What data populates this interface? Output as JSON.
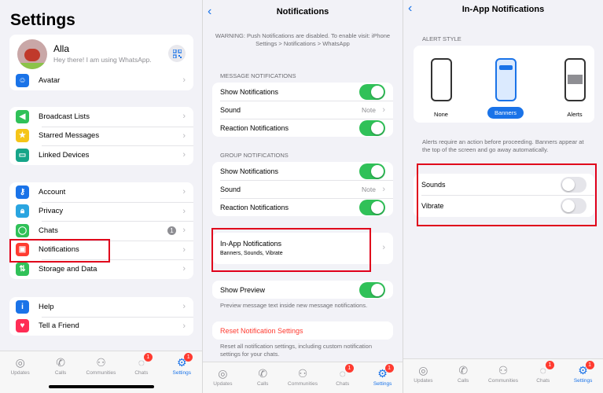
{
  "settings": {
    "title": "Settings",
    "profile": {
      "name": "Alla",
      "status": "Hey there! I am using WhatsApp."
    },
    "avatar_row": "Avatar",
    "group1": [
      "Broadcast Lists",
      "Starred Messages",
      "Linked Devices"
    ],
    "group2": [
      "Account",
      "Privacy",
      "Chats",
      "Notifications",
      "Storage and Data"
    ],
    "chats_badge": "1",
    "group3": [
      "Help",
      "Tell a Friend"
    ]
  },
  "tabs": {
    "updates": "Updates",
    "calls": "Calls",
    "communities": "Communities",
    "chats": "Chats",
    "settings": "Settings",
    "chats_badge": "1",
    "settings_badge": "1"
  },
  "notifications": {
    "title": "Notifications",
    "warning": "WARNING: Push Notifications are disabled. To enable visit: iPhone Settings > Notifications > WhatsApp",
    "message_header": "MESSAGE NOTIFICATIONS",
    "message_rows": {
      "show": "Show Notifications",
      "sound": "Sound",
      "sound_value": "Note",
      "reaction": "Reaction Notifications"
    },
    "group_header": "GROUP NOTIFICATIONS",
    "group_rows": {
      "show": "Show Notifications",
      "sound": "Sound",
      "sound_value": "Note",
      "reaction": "Reaction Notifications"
    },
    "inapp": {
      "title": "In-App Notifications",
      "subtitle": "Banners, Sounds, Vibrate"
    },
    "preview": {
      "label": "Show Preview",
      "note": "Preview message text inside new message notifications."
    },
    "reset": {
      "label": "Reset Notification Settings",
      "note": "Reset all notification settings, including custom notification settings for your chats."
    }
  },
  "inapp": {
    "title": "In-App Notifications",
    "style_header": "ALERT STYLE",
    "styles": [
      "None",
      "Banners",
      "Alerts"
    ],
    "selected_style": "Banners",
    "note": "Alerts require an action before proceeding. Banners appear at the top of the screen and go away automatically.",
    "sounds": "Sounds",
    "vibrate": "Vibrate",
    "sounds_on": false,
    "vibrate_on": false
  },
  "colors": {
    "accent": "#1a73e8",
    "toggle_on": "#30c158",
    "highlight": "#e0001b",
    "destructive": "#ff3b30"
  }
}
